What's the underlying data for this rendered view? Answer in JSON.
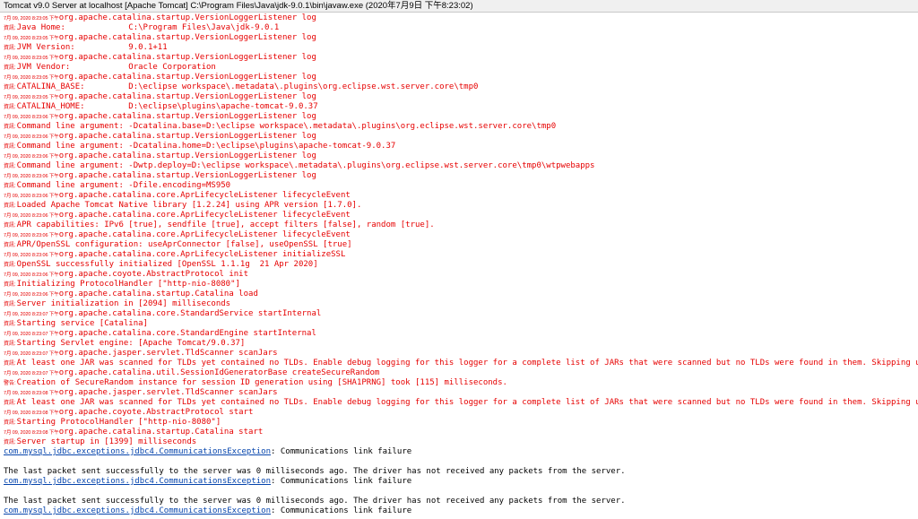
{
  "window": {
    "title": "Tomcat v9.0 Server at localhost [Apache Tomcat] C:\\Program Files\\Java\\jdk-9.0.1\\bin\\javaw.exe  (2020年7月9日 下午8:23:02)"
  },
  "colors": {
    "error_red": "#e60000",
    "link_blue": "#0645ad",
    "normal_black": "#000000"
  },
  "console": {
    "lines": [
      {
        "kind": "hdr",
        "ts": "7月 09, 2020 8:23:05 下午",
        "text": "org.apache.catalina.startup.VersionLoggerListener log"
      },
      {
        "kind": "msg",
        "lvl": "資訊:",
        "text": "Java Home:             C:\\Program Files\\Java\\jdk-9.0.1"
      },
      {
        "kind": "hdr",
        "ts": "7月 09, 2020 8:23:05 下午",
        "text": "org.apache.catalina.startup.VersionLoggerListener log"
      },
      {
        "kind": "msg",
        "lvl": "資訊:",
        "text": "JVM Version:           9.0.1+11"
      },
      {
        "kind": "hdr",
        "ts": "7月 09, 2020 8:23:05 下午",
        "text": "org.apache.catalina.startup.VersionLoggerListener log"
      },
      {
        "kind": "msg",
        "lvl": "資訊:",
        "text": "JVM Vendor:            Oracle Corporation"
      },
      {
        "kind": "hdr",
        "ts": "7月 09, 2020 8:23:05 下午",
        "text": "org.apache.catalina.startup.VersionLoggerListener log"
      },
      {
        "kind": "msg",
        "lvl": "資訊:",
        "text": "CATALINA_BASE:         D:\\eclipse workspace\\.metadata\\.plugins\\org.eclipse.wst.server.core\\tmp0"
      },
      {
        "kind": "hdr",
        "ts": "7月 09, 2020 8:23:05 下午",
        "text": "org.apache.catalina.startup.VersionLoggerListener log"
      },
      {
        "kind": "msg",
        "lvl": "資訊:",
        "text": "CATALINA_HOME:         D:\\eclipse\\plugins\\apache-tomcat-9.0.37"
      },
      {
        "kind": "hdr",
        "ts": "7月 09, 2020 8:23:06 下午",
        "text": "org.apache.catalina.startup.VersionLoggerListener log"
      },
      {
        "kind": "msg",
        "lvl": "資訊:",
        "text": "Command line argument: -Dcatalina.base=D:\\eclipse workspace\\.metadata\\.plugins\\org.eclipse.wst.server.core\\tmp0"
      },
      {
        "kind": "hdr",
        "ts": "7月 09, 2020 8:23:06 下午",
        "text": "org.apache.catalina.startup.VersionLoggerListener log"
      },
      {
        "kind": "msg",
        "lvl": "資訊:",
        "text": "Command line argument: -Dcatalina.home=D:\\eclipse\\plugins\\apache-tomcat-9.0.37"
      },
      {
        "kind": "hdr",
        "ts": "7月 09, 2020 8:23:06 下午",
        "text": "org.apache.catalina.startup.VersionLoggerListener log"
      },
      {
        "kind": "msg",
        "lvl": "資訊:",
        "text": "Command line argument: -Dwtp.deploy=D:\\eclipse workspace\\.metadata\\.plugins\\org.eclipse.wst.server.core\\tmp0\\wtpwebapps"
      },
      {
        "kind": "hdr",
        "ts": "7月 09, 2020 8:23:06 下午",
        "text": "org.apache.catalina.startup.VersionLoggerListener log"
      },
      {
        "kind": "msg",
        "lvl": "資訊:",
        "text": "Command line argument: -Dfile.encoding=MS950"
      },
      {
        "kind": "hdr",
        "ts": "7月 09, 2020 8:23:06 下午",
        "text": "org.apache.catalina.core.AprLifecycleListener lifecycleEvent"
      },
      {
        "kind": "msg",
        "lvl": "資訊:",
        "text": "Loaded Apache Tomcat Native library [1.2.24] using APR version [1.7.0]."
      },
      {
        "kind": "hdr",
        "ts": "7月 09, 2020 8:23:06 下午",
        "text": "org.apache.catalina.core.AprLifecycleListener lifecycleEvent"
      },
      {
        "kind": "msg",
        "lvl": "資訊:",
        "text": "APR capabilities: IPv6 [true], sendfile [true], accept filters [false], random [true]."
      },
      {
        "kind": "hdr",
        "ts": "7月 09, 2020 8:23:06 下午",
        "text": "org.apache.catalina.core.AprLifecycleListener lifecycleEvent"
      },
      {
        "kind": "msg",
        "lvl": "資訊:",
        "text": "APR/OpenSSL configuration: useAprConnector [false], useOpenSSL [true]"
      },
      {
        "kind": "hdr",
        "ts": "7月 09, 2020 8:23:06 下午",
        "text": "org.apache.catalina.core.AprLifecycleListener initializeSSL"
      },
      {
        "kind": "msg",
        "lvl": "資訊:",
        "text": "OpenSSL successfully initialized [OpenSSL 1.1.1g  21 Apr 2020]"
      },
      {
        "kind": "hdr",
        "ts": "7月 09, 2020 8:23:06 下午",
        "text": "org.apache.coyote.AbstractProtocol init"
      },
      {
        "kind": "msg",
        "lvl": "資訊:",
        "text": "Initializing ProtocolHandler [\"http-nio-8080\"]"
      },
      {
        "kind": "hdr",
        "ts": "7月 09, 2020 8:23:06 下午",
        "text": "org.apache.catalina.startup.Catalina load"
      },
      {
        "kind": "msg",
        "lvl": "資訊:",
        "text": "Server initialization in [2094] milliseconds"
      },
      {
        "kind": "hdr",
        "ts": "7月 09, 2020 8:23:07 下午",
        "text": "org.apache.catalina.core.StandardService startInternal"
      },
      {
        "kind": "msg",
        "lvl": "資訊:",
        "text": "Starting service [Catalina]"
      },
      {
        "kind": "hdr",
        "ts": "7月 09, 2020 8:23:07 下午",
        "text": "org.apache.catalina.core.StandardEngine startInternal"
      },
      {
        "kind": "msg",
        "lvl": "資訊:",
        "text": "Starting Servlet engine: [Apache Tomcat/9.0.37]"
      },
      {
        "kind": "hdr",
        "ts": "7月 09, 2020 8:23:07 下午",
        "text": "org.apache.jasper.servlet.TldScanner scanJars"
      },
      {
        "kind": "msg",
        "lvl": "資訊:",
        "text": "At least one JAR was scanned for TLDs yet contained no TLDs. Enable debug logging for this logger for a complete list of JARs that were scanned but no TLDs were found in them. Skipping unneeded JARs"
      },
      {
        "kind": "hdr",
        "ts": "7月 09, 2020 8:23:07 下午",
        "text": "org.apache.catalina.util.SessionIdGeneratorBase createSecureRandom"
      },
      {
        "kind": "msg",
        "lvl": "警告:",
        "text": "Creation of SecureRandom instance for session ID generation using [SHA1PRNG] took [115] milliseconds."
      },
      {
        "kind": "hdr",
        "ts": "7月 09, 2020 8:23:08 下午",
        "text": "org.apache.jasper.servlet.TldScanner scanJars"
      },
      {
        "kind": "msg",
        "lvl": "資訊:",
        "text": "At least one JAR was scanned for TLDs yet contained no TLDs. Enable debug logging for this logger for a complete list of JARs that were scanned but no TLDs were found in them. Skipping unneeded JARs"
      },
      {
        "kind": "hdr",
        "ts": "7月 09, 2020 8:23:08 下午",
        "text": "org.apache.coyote.AbstractProtocol start"
      },
      {
        "kind": "msg",
        "lvl": "資訊:",
        "text": "Starting ProtocolHandler [\"http-nio-8080\"]"
      },
      {
        "kind": "hdr",
        "ts": "7月 09, 2020 8:23:08 下午",
        "text": "org.apache.catalina.startup.Catalina start"
      },
      {
        "kind": "msg",
        "lvl": "資訊:",
        "text": "Server startup in [1399] milliseconds"
      },
      {
        "kind": "link",
        "link": "com.mysql.jdbc.exceptions.jdbc4.CommunicationsException",
        "text": ": Communications link failure"
      },
      {
        "kind": "blank"
      },
      {
        "kind": "plain",
        "text": "The last packet sent successfully to the server was 0 milliseconds ago. The driver has not received any packets from the server."
      },
      {
        "kind": "link",
        "link": "com.mysql.jdbc.exceptions.jdbc4.CommunicationsException",
        "text": ": Communications link failure"
      },
      {
        "kind": "blank"
      },
      {
        "kind": "plain",
        "text": "The last packet sent successfully to the server was 0 milliseconds ago. The driver has not received any packets from the server."
      },
      {
        "kind": "link",
        "link": "com.mysql.jdbc.exceptions.jdbc4.CommunicationsException",
        "text": ": Communications link failure"
      }
    ]
  }
}
